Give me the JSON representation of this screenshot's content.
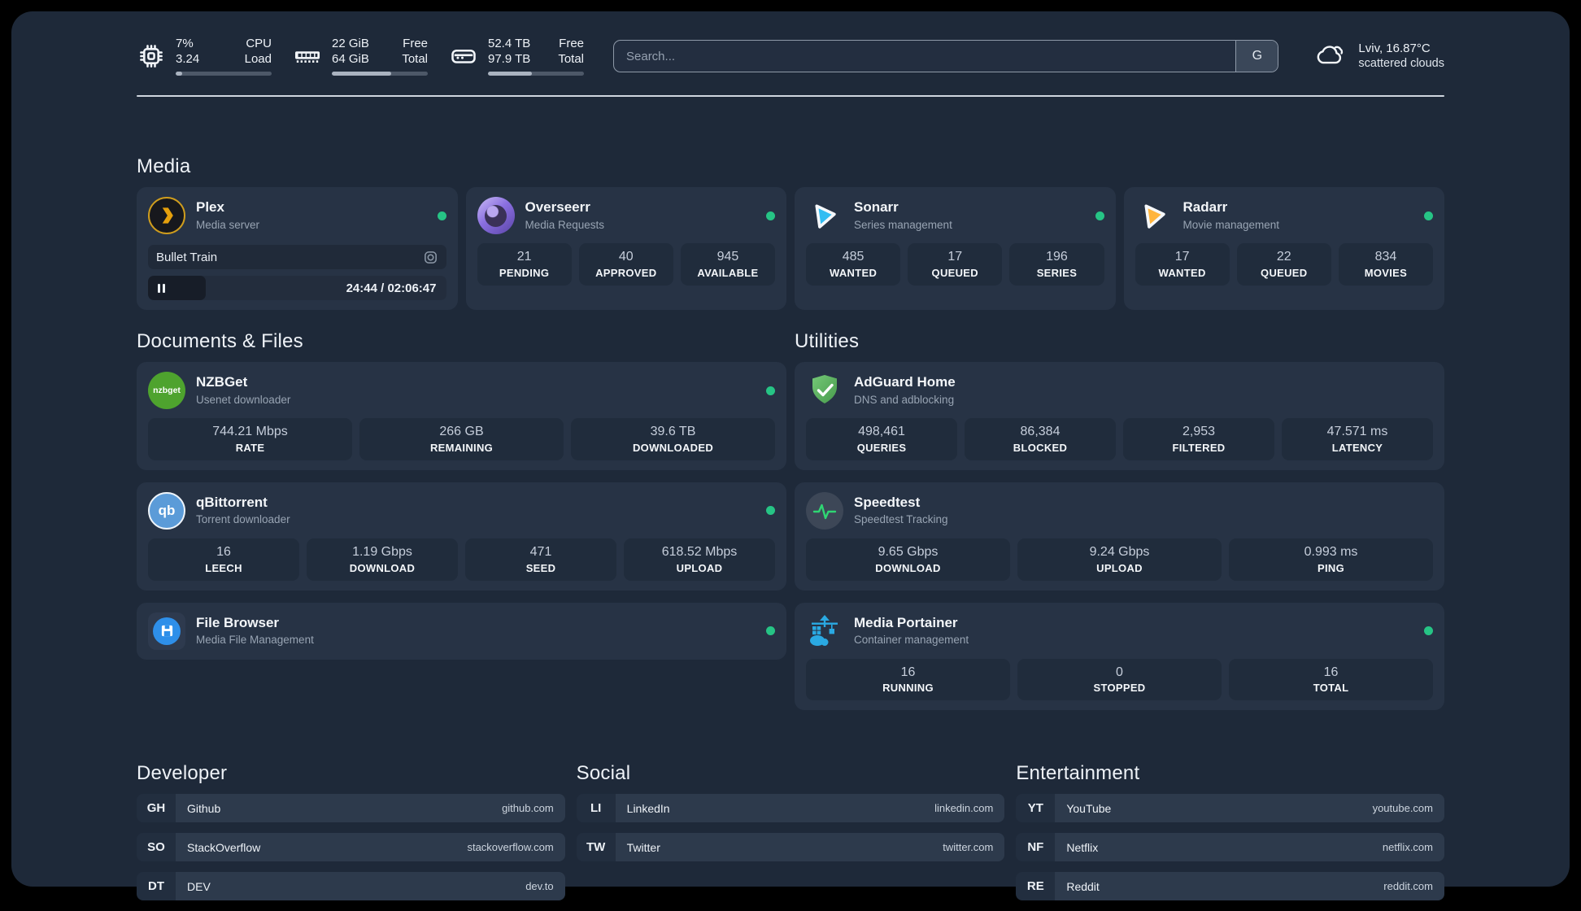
{
  "header": {
    "metrics": [
      {
        "value1": "7%",
        "value2": "3.24",
        "label1": "CPU",
        "label2": "Load",
        "progress": 7
      },
      {
        "value1": "22 GiB",
        "value2": "64 GiB",
        "label1": "Free",
        "label2": "Total",
        "progress": 62
      },
      {
        "value1": "52.4 TB",
        "value2": "97.9 TB",
        "label1": "Free",
        "label2": "Total",
        "progress": 46
      }
    ],
    "search": {
      "placeholder": "Search...",
      "engine_button": "G"
    },
    "weather": {
      "location": "Lviv, 16.87°C",
      "condition": "scattered clouds"
    }
  },
  "media": {
    "title": "Media",
    "plex": {
      "name": "Plex",
      "subtitle": "Media server",
      "now_playing": "Bullet Train",
      "time_display": "24:44 / 02:06:47",
      "progress_percent": 19.5,
      "online": true
    },
    "overseerr": {
      "name": "Overseerr",
      "subtitle": "Media Requests",
      "online": true,
      "stats": [
        {
          "value": "21",
          "label": "PENDING"
        },
        {
          "value": "40",
          "label": "APPROVED"
        },
        {
          "value": "945",
          "label": "AVAILABLE"
        }
      ]
    },
    "sonarr": {
      "name": "Sonarr",
      "subtitle": "Series management",
      "online": true,
      "stats": [
        {
          "value": "485",
          "label": "WANTED"
        },
        {
          "value": "17",
          "label": "QUEUED"
        },
        {
          "value": "196",
          "label": "SERIES"
        }
      ]
    },
    "radarr": {
      "name": "Radarr",
      "subtitle": "Movie management",
      "online": true,
      "stats": [
        {
          "value": "17",
          "label": "WANTED"
        },
        {
          "value": "22",
          "label": "QUEUED"
        },
        {
          "value": "834",
          "label": "MOVIES"
        }
      ]
    }
  },
  "documents": {
    "title": "Documents & Files",
    "nzbget": {
      "name": "NZBGet",
      "subtitle": "Usenet downloader",
      "online": true,
      "stats": [
        {
          "value": "744.21 Mbps",
          "label": "RATE"
        },
        {
          "value": "266 GB",
          "label": "REMAINING"
        },
        {
          "value": "39.6 TB",
          "label": "DOWNLOADED"
        }
      ]
    },
    "qbittorrent": {
      "name": "qBittorrent",
      "subtitle": "Torrent downloader",
      "online": true,
      "stats": [
        {
          "value": "16",
          "label": "LEECH"
        },
        {
          "value": "1.19 Gbps",
          "label": "DOWNLOAD"
        },
        {
          "value": "471",
          "label": "SEED"
        },
        {
          "value": "618.52 Mbps",
          "label": "UPLOAD"
        }
      ]
    },
    "filebrowser": {
      "name": "File Browser",
      "subtitle": "Media File Management",
      "online": true
    }
  },
  "utilities": {
    "title": "Utilities",
    "adguard": {
      "name": "AdGuard Home",
      "subtitle": "DNS and adblocking",
      "stats": [
        {
          "value": "498,461",
          "label": "QUERIES"
        },
        {
          "value": "86,384",
          "label": "BLOCKED"
        },
        {
          "value": "2,953",
          "label": "FILTERED"
        },
        {
          "value": "47.571 ms",
          "label": "LATENCY"
        }
      ]
    },
    "speedtest": {
      "name": "Speedtest",
      "subtitle": "Speedtest Tracking",
      "stats": [
        {
          "value": "9.65 Gbps",
          "label": "DOWNLOAD"
        },
        {
          "value": "9.24 Gbps",
          "label": "UPLOAD"
        },
        {
          "value": "0.993 ms",
          "label": "PING"
        }
      ]
    },
    "portainer": {
      "name": "Media Portainer",
      "subtitle": "Container management",
      "online": true,
      "stats": [
        {
          "value": "16",
          "label": "RUNNING"
        },
        {
          "value": "0",
          "label": "STOPPED"
        },
        {
          "value": "16",
          "label": "TOTAL"
        }
      ]
    }
  },
  "links": {
    "developer": {
      "title": "Developer",
      "items": [
        {
          "abbr": "GH",
          "name": "Github",
          "url": "github.com"
        },
        {
          "abbr": "SO",
          "name": "StackOverflow",
          "url": "stackoverflow.com"
        },
        {
          "abbr": "DT",
          "name": "DEV",
          "url": "dev.to"
        }
      ]
    },
    "social": {
      "title": "Social",
      "items": [
        {
          "abbr": "LI",
          "name": "LinkedIn",
          "url": "linkedin.com"
        },
        {
          "abbr": "TW",
          "name": "Twitter",
          "url": "twitter.com"
        }
      ]
    },
    "entertainment": {
      "title": "Entertainment",
      "items": [
        {
          "abbr": "YT",
          "name": "YouTube",
          "url": "youtube.com"
        },
        {
          "abbr": "NF",
          "name": "Netflix",
          "url": "netflix.com"
        },
        {
          "abbr": "RE",
          "name": "Reddit",
          "url": "reddit.com"
        }
      ]
    }
  },
  "colors": {
    "status_online": "#26c485",
    "plex_accent": "#e5a00d",
    "background": "#1e2939",
    "card": "#273345"
  }
}
